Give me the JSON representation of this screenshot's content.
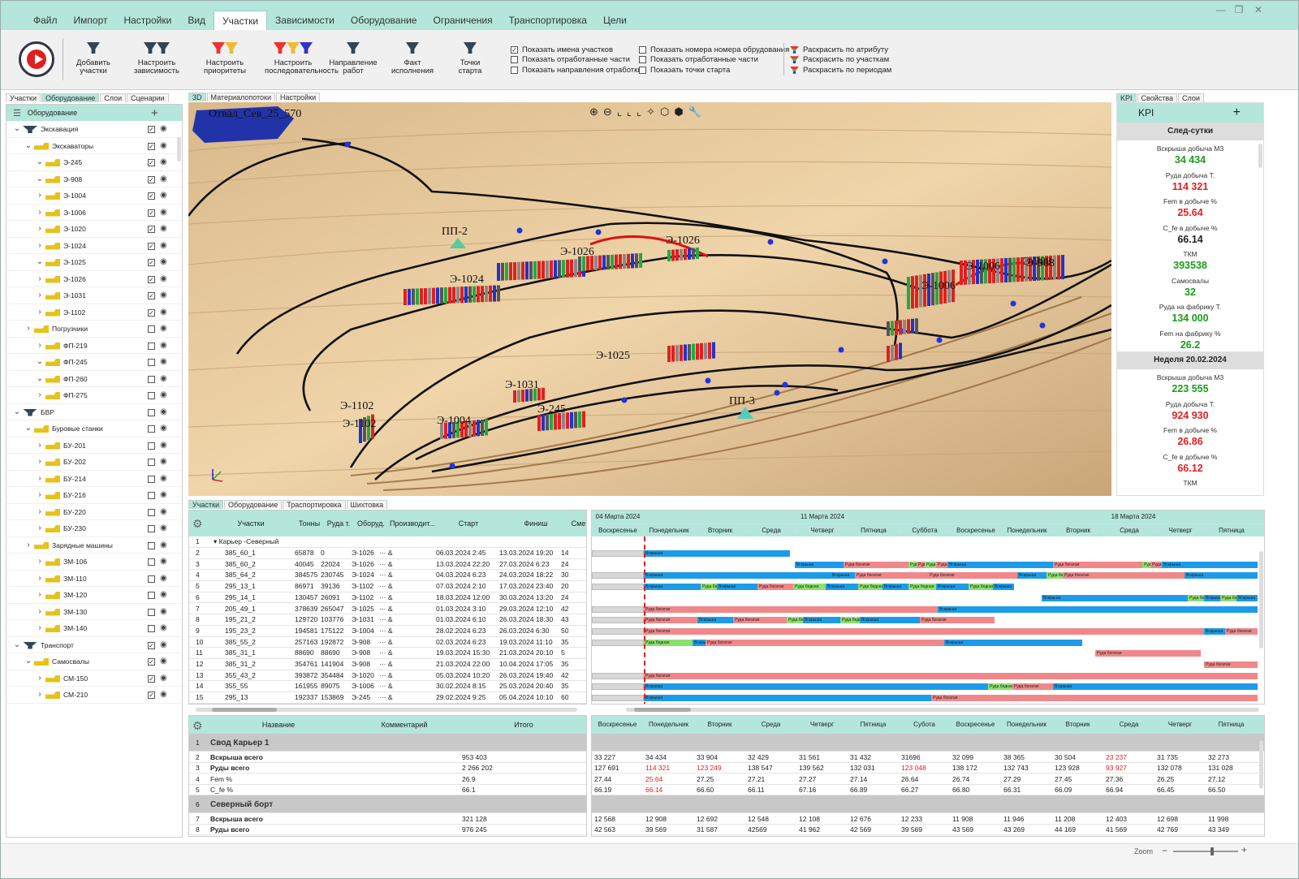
{
  "menu": [
    "Файл",
    "Импорт",
    "Настройки",
    "Вид",
    "Участки",
    "Зависимости",
    "Оборудование",
    "Ограничения",
    "Транспортировка",
    "Цели"
  ],
  "ribbon": {
    "buttons": [
      "Добавить участки",
      "Настроить зависимость",
      "Настроить приоритеты",
      "Настроить последовательность",
      "Направление работ",
      "Факт исполнения",
      "Точки старта"
    ],
    "checks1": [
      {
        "label": "Показать имена участков",
        "checked": true
      },
      {
        "label": "Показать отработанные части",
        "checked": false
      },
      {
        "label": "Показать направления отработки",
        "checked": false
      }
    ],
    "checks2": [
      {
        "label": "Показать номера номера обрудования",
        "checked": false
      },
      {
        "label": "Показать отработанные части",
        "checked": false
      },
      {
        "label": "Показать точки старта",
        "checked": false
      }
    ],
    "colorize": [
      "Раскрасить по атрибуту",
      "Раскрасить по участкам",
      "Раскрасить по периодам"
    ]
  },
  "left_tabs": [
    "Участки",
    "Оборудование",
    "Слои",
    "Сценарии"
  ],
  "left_header": "Оборудование",
  "tree": [
    {
      "label": "Экскавация",
      "level": 0,
      "arrow": "v",
      "checked": true
    },
    {
      "label": "Экскаваторы",
      "level": 1,
      "arrow": "v",
      "checked": true
    },
    {
      "label": "Э-245",
      "level": 2,
      "arrow": "v",
      "checked": true
    },
    {
      "label": "Э-908",
      "level": 2,
      "arrow": "v",
      "checked": true
    },
    {
      "label": "Э-1004",
      "level": 2,
      "arrow": ">",
      "checked": true
    },
    {
      "label": "Э-1006",
      "level": 2,
      "arrow": ">",
      "checked": true
    },
    {
      "label": "Э-1020",
      "level": 2,
      "arrow": ">",
      "checked": true
    },
    {
      "label": "Э-1024",
      "level": 2,
      "arrow": ">",
      "checked": true
    },
    {
      "label": "Э-1025",
      "level": 2,
      "arrow": "v",
      "checked": true
    },
    {
      "label": "Э-1026",
      "level": 2,
      "arrow": ">",
      "checked": true
    },
    {
      "label": "Э-1031",
      "level": 2,
      "arrow": ">",
      "checked": true
    },
    {
      "label": "Э-1102",
      "level": 2,
      "arrow": ">",
      "checked": true
    },
    {
      "label": "Погрузчики",
      "level": 1,
      "arrow": ">",
      "checked": false
    },
    {
      "label": "ФП-219",
      "level": 2,
      "arrow": ">",
      "checked": false
    },
    {
      "label": "ФП-245",
      "level": 2,
      "arrow": "v",
      "checked": false
    },
    {
      "label": "ФП-260",
      "level": 2,
      "arrow": "v",
      "checked": false
    },
    {
      "label": "ФП-275",
      "level": 2,
      "arrow": ">",
      "checked": false
    },
    {
      "label": "БВР",
      "level": 0,
      "arrow": "v",
      "checked": false
    },
    {
      "label": "Буровые станки",
      "level": 1,
      "arrow": "v",
      "checked": false
    },
    {
      "label": "БУ-201",
      "level": 2,
      "arrow": ">",
      "checked": false
    },
    {
      "label": "БУ-202",
      "level": 2,
      "arrow": ">",
      "checked": false
    },
    {
      "label": "БУ-214",
      "level": 2,
      "arrow": ">",
      "checked": false
    },
    {
      "label": "БУ-216",
      "level": 2,
      "arrow": ">",
      "checked": false
    },
    {
      "label": "БУ-220",
      "level": 2,
      "arrow": ">",
      "checked": false
    },
    {
      "label": "БУ-230",
      "level": 2,
      "arrow": ">",
      "checked": false
    },
    {
      "label": "Зарядные машины",
      "level": 1,
      "arrow": ">",
      "checked": false
    },
    {
      "label": "ЗМ-106",
      "level": 2,
      "arrow": ">",
      "checked": false
    },
    {
      "label": "ЗМ-110",
      "level": 2,
      "arrow": ">",
      "checked": false
    },
    {
      "label": "ЗМ-120",
      "level": 2,
      "arrow": ">",
      "checked": false
    },
    {
      "label": "ЗМ-130",
      "level": 2,
      "arrow": ">",
      "checked": false
    },
    {
      "label": "ЗМ-140",
      "level": 2,
      "arrow": ">",
      "checked": false
    },
    {
      "label": "Транспорт",
      "level": 0,
      "arrow": "v",
      "checked": true
    },
    {
      "label": "Самосвалы",
      "level": 1,
      "arrow": "v",
      "checked": true
    },
    {
      "label": "СМ-150",
      "level": 2,
      "arrow": ">",
      "checked": true
    },
    {
      "label": "СМ-210",
      "level": 2,
      "arrow": ">",
      "checked": true
    }
  ],
  "view_tabs": [
    "3D",
    "Материалопотоки",
    "Настройки"
  ],
  "map_labels": [
    "Отвал_Сев_25_570",
    "ПП-2",
    "Э-1024",
    "Э-1026",
    "Э-1026",
    "Э-908",
    "Э-1006",
    "Э-1006",
    "Э-908",
    "Э-1025",
    "Э-1031",
    "Э-1102",
    "Э-1102",
    "Э-1004",
    "Э-245",
    "ПП-3"
  ],
  "kpi_tabs": [
    "KPI",
    "Свойства",
    "Слои"
  ],
  "kpi": {
    "title": "KPI",
    "sections": [
      {
        "title": "След-сутки",
        "items": [
          {
            "k": "Вскрыша добыча М3",
            "v": "34 434",
            "color": "green"
          },
          {
            "k": "Руда добыча Т.",
            "v": "114 321",
            "color": "red"
          },
          {
            "k": "Fem в добыче %",
            "v": "25.64",
            "color": "red"
          },
          {
            "k": "C_fe в добыче %",
            "v": "66.14",
            "color": "black"
          },
          {
            "k": "ТКМ",
            "v": "393538",
            "color": "green"
          },
          {
            "k": "Самосвалы",
            "v": "32",
            "color": "green"
          },
          {
            "k": "Руда на фабрику Т.",
            "v": "134 000",
            "color": "green"
          },
          {
            "k": "Fem на фабрику %",
            "v": "26.2",
            "color": "green"
          }
        ]
      },
      {
        "title": "Неделя 20.02.2024",
        "items": [
          {
            "k": "Вскрыша добыча М3",
            "v": "223 555",
            "color": "green"
          },
          {
            "k": "Руда добыча Т.",
            "v": "924 930",
            "color": "red"
          },
          {
            "k": "Fem в добыче %",
            "v": "26.86",
            "color": "red"
          },
          {
            "k": "C_fe в добыче %",
            "v": "66.12",
            "color": "red"
          },
          {
            "k": "ТКМ",
            "v": "",
            "color": "black"
          }
        ]
      }
    ]
  },
  "bottom_tabs": [
    "Участки",
    "Оборудование",
    "Траспортировка",
    "Шихтовка"
  ],
  "grid": {
    "headers": [
      "Участки",
      "Тонны",
      "Руда т.",
      "Оборуд.",
      "Производит...",
      "Старт",
      "Финиш",
      "Смен"
    ],
    "group": "Карьер -Северный",
    "rows": [
      [
        "2",
        "385_60_1",
        "65878",
        "0",
        "Э-1026",
        "06.03.2024  2:45",
        "13.03.2024  19:20",
        "14"
      ],
      [
        "3",
        "385_60_2",
        "40045",
        "22024",
        "Э-1026",
        "13.03.2024  22:20",
        "27.03.2024  6:23",
        "24"
      ],
      [
        "4",
        "385_64_2",
        "384575",
        "230745",
        "Э-1024",
        "04.03.2024  6:23",
        "24.03.2024  18:22",
        "30"
      ],
      [
        "5",
        "295_13_1",
        "86971",
        "39136",
        "Э-1102",
        "07.03.2024  2:10",
        "17.03.2024  23:40",
        "20"
      ],
      [
        "6",
        "295_14_1",
        "130457",
        "26091",
        "Э-1102",
        "18.03.2024  12:00",
        "30.03.2024  13:20",
        "24"
      ],
      [
        "7",
        "205_49_1",
        "378639",
        "265047",
        "Э-1025",
        "01.03.2024  3:10",
        "29.03.2024  12:10",
        "42"
      ],
      [
        "8",
        "195_21_2",
        "129720",
        "103776",
        "Э-1031",
        "01.03.2024  6:10",
        "26.03.2024  18:30",
        "43"
      ],
      [
        "9",
        "195_23_2",
        "194581",
        "175122",
        "Э-1004",
        "28.02.2024  6:23",
        "26.03.2024  6:30",
        "50"
      ],
      [
        "10",
        "385_55_2",
        "257163",
        "192872",
        "Э-908",
        "02.03.2024  6:23",
        "19.03.2024  11:10",
        "35"
      ],
      [
        "11",
        "385_31_1",
        "88690",
        "88690",
        "Э-908",
        "19.03.2024  15:30",
        "21.03.2024  20:10",
        "5"
      ],
      [
        "12",
        "385_31_2",
        "354761",
        "141904",
        "Э-908",
        "21.03.2024  22:00",
        "10.04.2024  17:05",
        "35"
      ],
      [
        "13",
        "355_43_2",
        "393872",
        "354484",
        "Э-1020",
        "05.03.2024  10:20",
        "26.03.2024  19:40",
        "42"
      ],
      [
        "14",
        "355_55",
        "161955",
        "89075",
        "Э-1006",
        "30.02.2024  8:15",
        "25.03.2024  20:40",
        "35"
      ],
      [
        "15",
        "295_13",
        "192337",
        "153869",
        "Э-245",
        "29.02.2024  9:25",
        "05.04.2024  10:10",
        "60"
      ]
    ]
  },
  "gantt": {
    "weeks": [
      "04 Марта 2024",
      "11 Марта 2024",
      "18 Марта 2024"
    ],
    "days": [
      "Воскресенье",
      "Понедельник",
      "Вторник",
      "Среда",
      "Четверг",
      "Пятница",
      "Суббота",
      "Воскресенье",
      "Понедельник",
      "Вторник",
      "Среда",
      "Четверг",
      "Пятница"
    ],
    "bar_labels": {
      "blue": "Вскрыша",
      "red": "Руда богатая",
      "green": "Руда бедная"
    }
  },
  "summary": {
    "headers": [
      "Название",
      "Комментарий",
      "Итого"
    ],
    "days": [
      "Воскресенье",
      "Понедельник",
      "Вторник",
      "Среда",
      "Четверг",
      "Пятница",
      "Субота",
      "Воскресенье",
      "Понедельник",
      "Вторник",
      "Среда",
      "Четверг",
      "Пятница"
    ],
    "rows": [
      {
        "n": "1",
        "name": "Свод Карьер 1",
        "group": true,
        "total": "",
        "vals": []
      },
      {
        "n": "2",
        "name": "Вскрыша всего",
        "bold": true,
        "total": "953 403",
        "vals": [
          "33 227",
          "34 434",
          "33 904",
          "32 429",
          "31 561",
          "31 432",
          "31696",
          "32 099",
          "38 365",
          "30 504",
          "23 237",
          "31 735",
          "32 273"
        ],
        "red": [
          10
        ]
      },
      {
        "n": "3",
        "name": "Руды всего",
        "bold": true,
        "total": "2 266 202",
        "vals": [
          "127 691",
          "114 321",
          "123 249",
          "138 547",
          "139 562",
          "132 031",
          "123 048",
          "138 172",
          "132 743",
          "123 928",
          "93 927",
          "132 078",
          "131 028"
        ],
        "red": [
          1,
          2,
          6,
          10
        ]
      },
      {
        "n": "4",
        "name": "Fem %",
        "total": "26.9",
        "vals": [
          "27.44",
          "25.64",
          "27.25",
          "27.21",
          "27.27",
          "27.14",
          "26.64",
          "26.74",
          "27.29",
          "27.45",
          "27.36",
          "26.25",
          "27.12"
        ],
        "red": [
          1
        ]
      },
      {
        "n": "5",
        "name": "C_fe %",
        "total": "66.1",
        "vals": [
          "66.19",
          "66.14",
          "66.60",
          "66.11",
          "67.16",
          "66.89",
          "66.27",
          "66.80",
          "66.31",
          "66.09",
          "66.94",
          "66.45",
          "66.50"
        ],
        "red": [
          1
        ]
      },
      {
        "n": "6",
        "name": "Северный борт",
        "group": true,
        "total": "",
        "vals": []
      },
      {
        "n": "7",
        "name": "Вскрыша всего",
        "bold": true,
        "total": "321 128",
        "vals": [
          "12 568",
          "12 908",
          "12 692",
          "12 548",
          "12 108",
          "12 676",
          "12 233",
          "11 908",
          "11 946",
          "11 208",
          "12 403",
          "12 698",
          "11 998"
        ],
        "red": []
      },
      {
        "n": "8",
        "name": "Руды всего",
        "bold": true,
        "total": "976 245",
        "vals": [
          "42 563",
          "39 569",
          "31 587",
          "42569",
          "41 962",
          "42 569",
          "39 569",
          "43 569",
          "43 269",
          "44 169",
          "41 569",
          "42 769",
          "43 349"
        ],
        "red": []
      }
    ]
  },
  "status": {
    "zoom_label": "Zoom",
    "zoom_level": 0.6
  }
}
